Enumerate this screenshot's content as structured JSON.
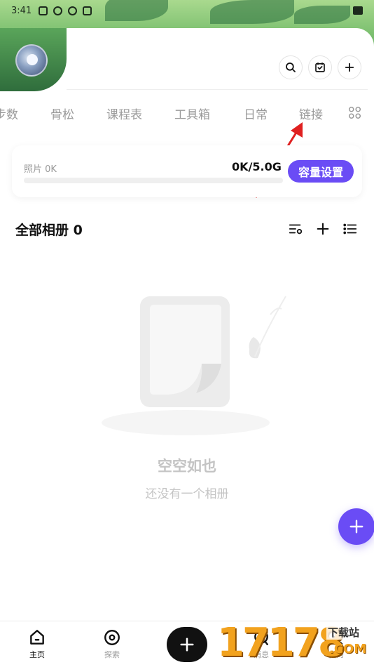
{
  "status_bar": {
    "time": "3:41"
  },
  "tabs": [
    {
      "label": "步数"
    },
    {
      "label": "骨松"
    },
    {
      "label": "课程表"
    },
    {
      "label": "工具箱"
    },
    {
      "label": "日常"
    },
    {
      "label": "链接"
    }
  ],
  "storage": {
    "photos_label": "照片 0K",
    "usage_text": "0K/5.0G",
    "used_fraction": 0,
    "capacity_button": "容量设置"
  },
  "albums": {
    "header": "全部相册 0"
  },
  "empty_state": {
    "title": "空空如也",
    "subtitle": "还没有一个相册"
  },
  "bottom_nav": {
    "home": "主页",
    "explore": "探索",
    "messages": "消息",
    "profile": "我的"
  },
  "watermark": {
    "digits": "17178",
    "word": "下载站",
    "com": ".COM"
  },
  "colors": {
    "accent": "#6a4cf5",
    "tab_text": "#9a9a9a",
    "empty_text": "#c4c4c4"
  }
}
